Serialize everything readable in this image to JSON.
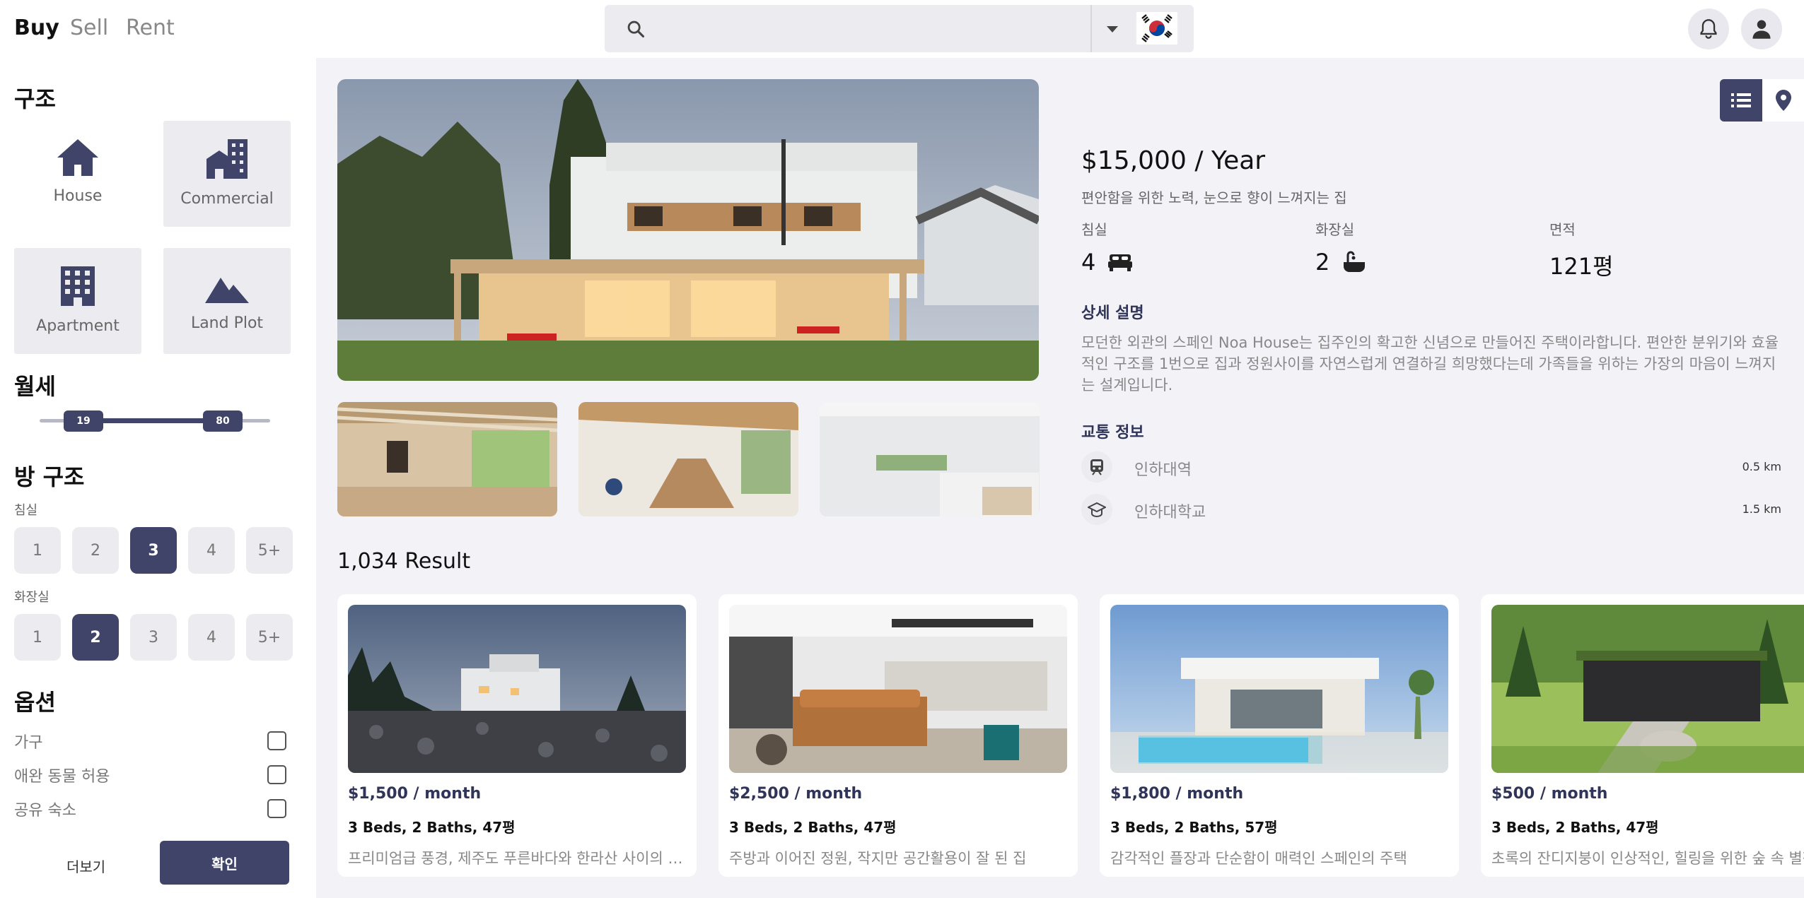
{
  "topbar": {
    "tabs": [
      "Buy",
      "Sell",
      "Rent"
    ],
    "search": {
      "value": "",
      "placeholder": ""
    }
  },
  "sidebar": {
    "structure_title": "구조",
    "types": [
      {
        "label": "House",
        "icon": "house-icon"
      },
      {
        "label": "Commercial",
        "icon": "commercial-building-icon"
      },
      {
        "label": "Apartment",
        "icon": "apartment-icon"
      },
      {
        "label": "Land Plot",
        "icon": "mountain-icon"
      }
    ],
    "rent_title": "월세",
    "range": {
      "min_label": "19",
      "max_label": "80",
      "min_value": 19,
      "max_value": 80
    },
    "room_title": "방 구조",
    "bedroom_label": "침실",
    "bathroom_label": "화장실",
    "bedroom_options": [
      "1",
      "2",
      "3",
      "4",
      "5+"
    ],
    "bedroom_selected": "3",
    "bathroom_options": [
      "1",
      "2",
      "3",
      "4",
      "5+"
    ],
    "bathroom_selected": "2",
    "options_title": "옵션",
    "options": [
      {
        "label": "가구",
        "checked": false
      },
      {
        "label": "애완 동물 허용",
        "checked": false
      },
      {
        "label": "공유 숙소",
        "checked": false
      }
    ],
    "more_label": "더보기",
    "confirm_label": "확인"
  },
  "detail": {
    "price": "$15,000 / Year",
    "tagline": "편안함을 위한 노력, 눈으로 향이 느껴지는 집",
    "stats": [
      {
        "label": "침실",
        "value": "4",
        "icon": "bed-icon"
      },
      {
        "label": "화장실",
        "value": "2",
        "icon": "bathtub-icon"
      },
      {
        "label": "면적",
        "value": "121평"
      }
    ],
    "description_title": "상세 설명",
    "description": "  모던한 외관의 스페인 Noa House는 집주인의 확고한 신념으로 만들어진 주택이라합니다. 편안한 분위기와 효율적인 구조를 1번으로 집과 정원사이를 자연스럽게 연결하길 희망했다는데 가족들을 위하는 가장의 마음이 느껴지는 설계입니다.",
    "transit_title": "교통 정보",
    "transit": [
      {
        "name": "인하대역",
        "distance": "0.5 km",
        "icon": "train-icon"
      },
      {
        "name": "인하대학교",
        "distance": "1.5 km",
        "icon": "graduation-cap-icon"
      }
    ]
  },
  "results": {
    "count_label": "1,034 Result",
    "cards": [
      {
        "price": "$1,500 / month",
        "specs": "3 Beds, 2 Baths, 47평",
        "desc": "프리미엄급 풍경, 제주도 푸른바다와 한라산 사이의 고급 주택"
      },
      {
        "price": "$2,500 / month",
        "specs": "3 Beds, 2 Baths, 47평",
        "desc": "주방과 이어진 정원, 작지만 공간활용이 잘 된 집"
      },
      {
        "price": "$1,800 / month",
        "specs": "3 Beds, 2 Baths, 57평",
        "desc": "감각적인 플장과 단순함이 매력인 스페인의 주택"
      },
      {
        "price": "$500 / month",
        "specs": "3 Beds, 2 Baths, 47평",
        "desc": "초록의 잔디지붕이 인상적인, 힐링을 위한 숲 속 별장"
      }
    ]
  },
  "colors": {
    "accent": "#3f4468",
    "background": "#f3f3f7"
  }
}
